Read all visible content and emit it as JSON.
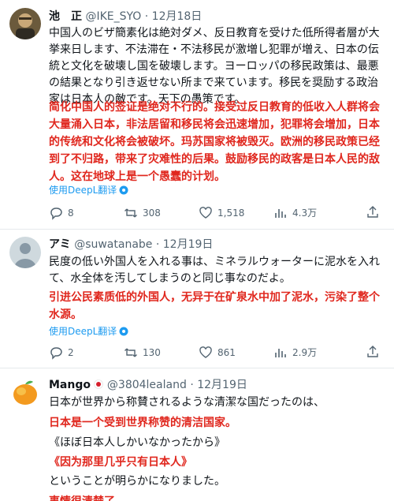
{
  "tweets": [
    {
      "name": "池　正",
      "handle": "@IKE_SYO",
      "dot": "·",
      "date": "12月18日",
      "body": "中国人のビザ簡素化は絶対ダメ、反日教育を受けた低所得者層が大挙来日します、不法滞在・不法移民が激増し犯罪が増え、日本の伝統と文化を破壊し国を破壊します。ヨーロッパの移民政策は、最悪の結果となり引き返せない所まで来ています。移民を奨励する政治家は日本人の敵です。天下の愚策です。",
      "translation": "简化中国人的签证是绝对不行的。接受过反日教育的低收入人群将会大量涌入日本，非法居留和移民将会迅速增加，犯罪将会增加，日本的传统和文化将会被破坏。玛苏国家将被毁灭。欧洲的移民政策已经到了不归路，带来了灾难性的后果。鼓励移民的政客是日本人民的敌人。这在地球上是一个愚蠢的计划。",
      "translate_link": "使用DeepL翻译",
      "replies": "8",
      "retweets": "308",
      "likes": "1,518",
      "views": "4.3万"
    },
    {
      "name": "アミ",
      "handle": "@suwatanabe",
      "dot": "·",
      "date": "12月19日",
      "body": "民度の低い外国人を入れる事は、ミネラルウォーターに泥水を入れて、水全体を汚してしまうのと同じ事なのだよ。",
      "translation": "引进公民素质低的外国人，无异于在矿泉水中加了泥水，污染了整个水源。",
      "translate_link": "使用DeepL翻译",
      "replies": "2",
      "retweets": "130",
      "likes": "861",
      "views": "2.9万"
    },
    {
      "name": "Mango",
      "handle": "@3804lealand",
      "dot": "·",
      "date": "12月19日",
      "body": "日本が世界から称賛されるような清潔な国だったのは、",
      "translation": "日本是一个受到世界称赞的清洁国家。",
      "quote": "《ほぼ日本人しかいなかったから》",
      "quote_translation": "《因为那里几乎只有日本人》",
      "body2": "ということが明らかになりました。",
      "translation2": "事情很清楚了。"
    }
  ],
  "colors": {
    "translation_red": "#e0271e",
    "link_blue": "#1d9bf0",
    "meta_gray": "#536471"
  }
}
